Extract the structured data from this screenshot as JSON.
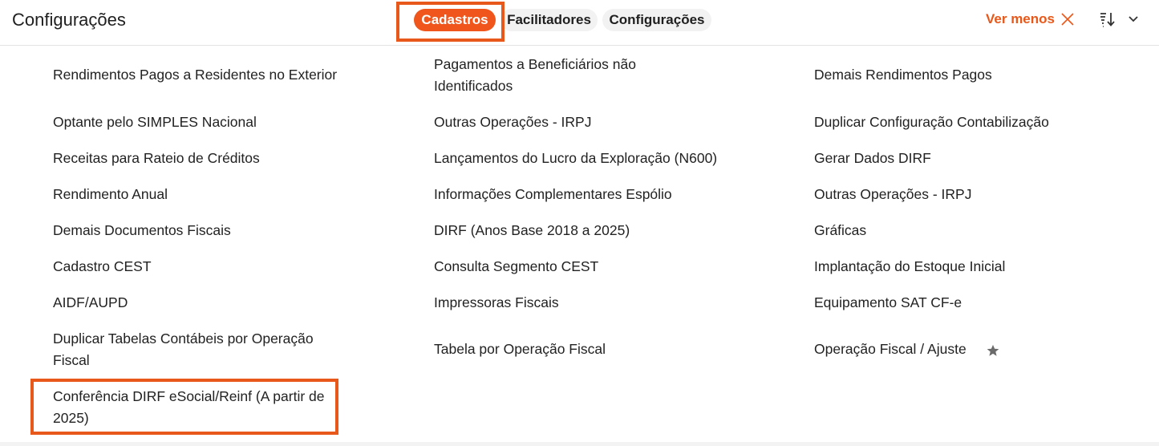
{
  "header": {
    "title": "Configurações",
    "tabs": [
      {
        "label": "Cadastros",
        "active": true
      },
      {
        "label": "Facilitadores",
        "active": false
      },
      {
        "label": "Configurações",
        "active": false
      }
    ],
    "ver_menos": "Ver menos",
    "accent_color": "#f0561b"
  },
  "menu": {
    "col1": [
      "Rendimentos Pagos a Residentes no Exterior",
      "Optante pelo SIMPLES Nacional",
      "Receitas para Rateio de Créditos",
      "Rendimento Anual",
      "Demais Documentos Fiscais",
      "Cadastro CEST",
      "AIDF/AUPD",
      "Duplicar Tabelas Contábeis por Operação Fiscal",
      "Conferência DIRF eSocial/Reinf (A partir de 2025)"
    ],
    "col2": [
      "Pagamentos a Beneficiários não Identificados",
      "Outras Operações - IRPJ",
      "Lançamentos do Lucro da Exploração (N600)",
      "Informações Complementares Espólio",
      "DIRF (Anos Base 2018 a 2025)",
      "Consulta Segmento CEST",
      "Impressoras Fiscais",
      "Tabela por Operação Fiscal"
    ],
    "col3": [
      "Demais Rendimentos Pagos",
      "Duplicar Configuração Contabilização",
      "Gerar Dados DIRF",
      "Outras Operações - IRPJ",
      "Gráficas",
      "Implantação do Estoque Inicial",
      "Equipamento SAT CF-e",
      "Operação Fiscal / Ajuste"
    ]
  },
  "icons": {
    "close": "close-icon",
    "sort": "sort-icon",
    "chevron": "chevron-down-icon",
    "favorite": "star-icon"
  }
}
